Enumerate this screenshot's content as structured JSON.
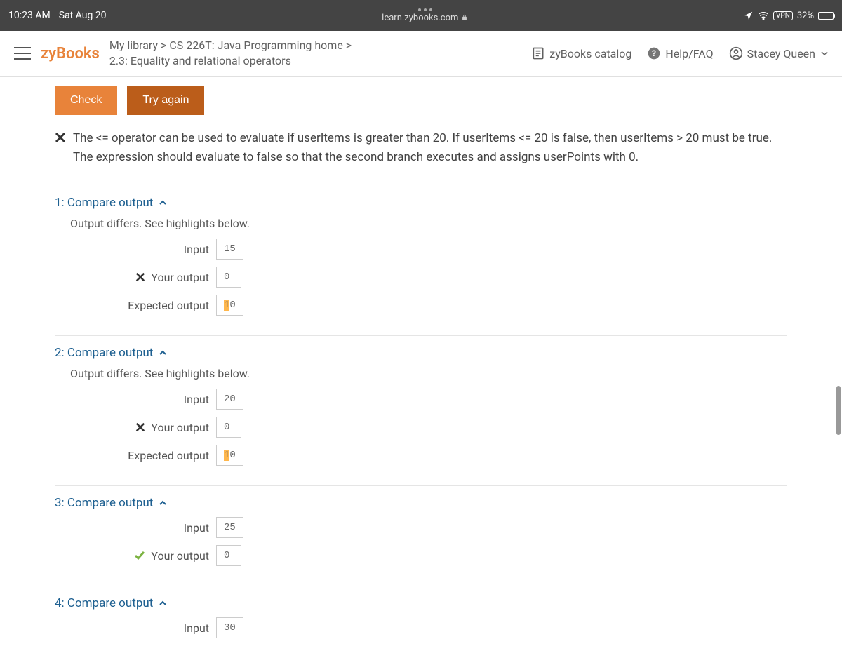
{
  "status_bar": {
    "time": "10:23 AM",
    "date": "Sat Aug 20",
    "url": "learn.zybooks.com",
    "vpn": "VPN",
    "battery_percent": "32%"
  },
  "header": {
    "logo": "zyBooks",
    "breadcrumb_line1": "My library > CS 226T: Java Programming home >",
    "breadcrumb_line2": "2.3: Equality and relational operators",
    "catalog": "zyBooks catalog",
    "help": "Help/FAQ",
    "user": "Stacey Queen"
  },
  "buttons": {
    "check": "Check",
    "try_again": "Try again"
  },
  "feedback": "The <= operator can be used to evaluate if userItems is greater than 20. If userItems <= 20 is false, then userItems > 20 must be true. The expression should evaluate to false so that the second branch executes and assigns userPoints with 0.",
  "labels": {
    "input": "Input",
    "your_output": "Your output",
    "expected_output": "Expected output",
    "output_differs": "Output differs. See highlights below."
  },
  "tests": [
    {
      "title": "1: Compare output",
      "differs": true,
      "input": "15",
      "your_output": "0",
      "correct": false,
      "expected_prefix_hl": "1",
      "expected_suffix": "0"
    },
    {
      "title": "2: Compare output",
      "differs": true,
      "input": "20",
      "your_output": "0",
      "correct": false,
      "expected_prefix_hl": "1",
      "expected_suffix": "0"
    },
    {
      "title": "3: Compare output",
      "differs": false,
      "input": "25",
      "your_output": "0",
      "correct": true
    },
    {
      "title": "4: Compare output",
      "differs": false,
      "input": "30"
    }
  ]
}
